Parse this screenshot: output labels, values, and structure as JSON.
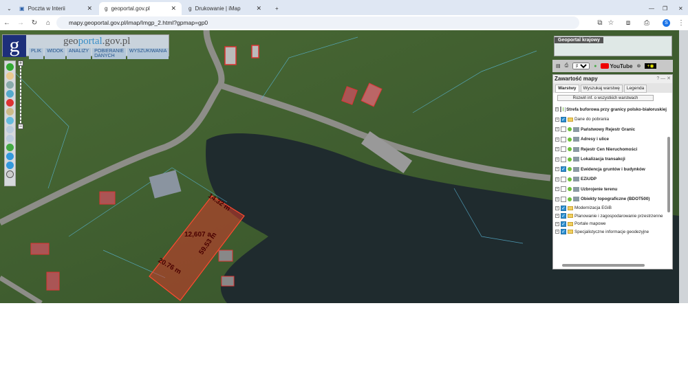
{
  "browser": {
    "tabs": [
      {
        "label": "Poczta w Interii"
      },
      {
        "label": "geoportal.gov.pl"
      },
      {
        "label": "Drukowanie | iMap"
      }
    ],
    "new_tab": "+",
    "url": "mapy.geoportal.gov.pl/imap/Imgp_2.html?gpmap=gp0",
    "profile": "S"
  },
  "app": {
    "logo_letter": "g",
    "site_prefix": "geo",
    "site_accent": "portal",
    "site_suffix": ".gov.pl",
    "menu": [
      "PLIK",
      "WIDOK",
      "ANALIZY",
      "POBIERANIE DANYCH",
      "WYSZUKIWANIA"
    ]
  },
  "minimap": {
    "title": "Geoportal krajowy"
  },
  "toolbar": {
    "language": "pol",
    "youtube": "YouTube"
  },
  "panel": {
    "title": "Zawartość mapy",
    "controls": "? — ✕",
    "tabs": [
      "Warstwy",
      "Wyszukaj warstwę",
      "Legenda"
    ],
    "expand_all": "Rozwiń inf. o wszystkich warstwach",
    "layers": [
      {
        "name": "Strefa buforowa przy granicy polsko-białoruskiej",
        "checked": false,
        "type": "service"
      },
      {
        "name": "Dane do pobrania",
        "checked": true,
        "type": "folder"
      },
      {
        "name": "Państwowy Rejestr Granic",
        "checked": false,
        "type": "service"
      },
      {
        "name": "Adresy i ulice",
        "checked": false,
        "type": "service"
      },
      {
        "name": "Rejestr Cen Nieruchomości",
        "checked": false,
        "type": "service"
      },
      {
        "name": "Lokalizacja transakcji",
        "checked": false,
        "type": "service"
      },
      {
        "name": "Ewidencja gruntów i budynków",
        "checked": true,
        "type": "service"
      },
      {
        "name": "EZiUDP",
        "checked": false,
        "type": "service"
      },
      {
        "name": "Uzbrojenie terenu",
        "checked": false,
        "type": "service"
      },
      {
        "name": "Obiekty topograficzne (BDOT500)",
        "checked": false,
        "type": "service"
      },
      {
        "name": "Modernizacja EGiB",
        "checked": true,
        "type": "folder"
      },
      {
        "name": "Planowanie i zagospodarowanie przestrzenne",
        "checked": true,
        "type": "folder"
      },
      {
        "name": "Portale mapowe",
        "checked": true,
        "type": "folder"
      },
      {
        "name": "Specjalistyczne informacje geodezyjne",
        "checked": true,
        "type": "folder"
      }
    ]
  },
  "measurements": {
    "top_edge": "14.32 m",
    "side_edge": "59.53 m",
    "bottom_edge": "20.76 m",
    "area": "12,607 a"
  },
  "colors": {
    "parcel": "#d23a2a",
    "panel_check": "#2d8fd0",
    "logo_bg": "#1d2f7a"
  }
}
